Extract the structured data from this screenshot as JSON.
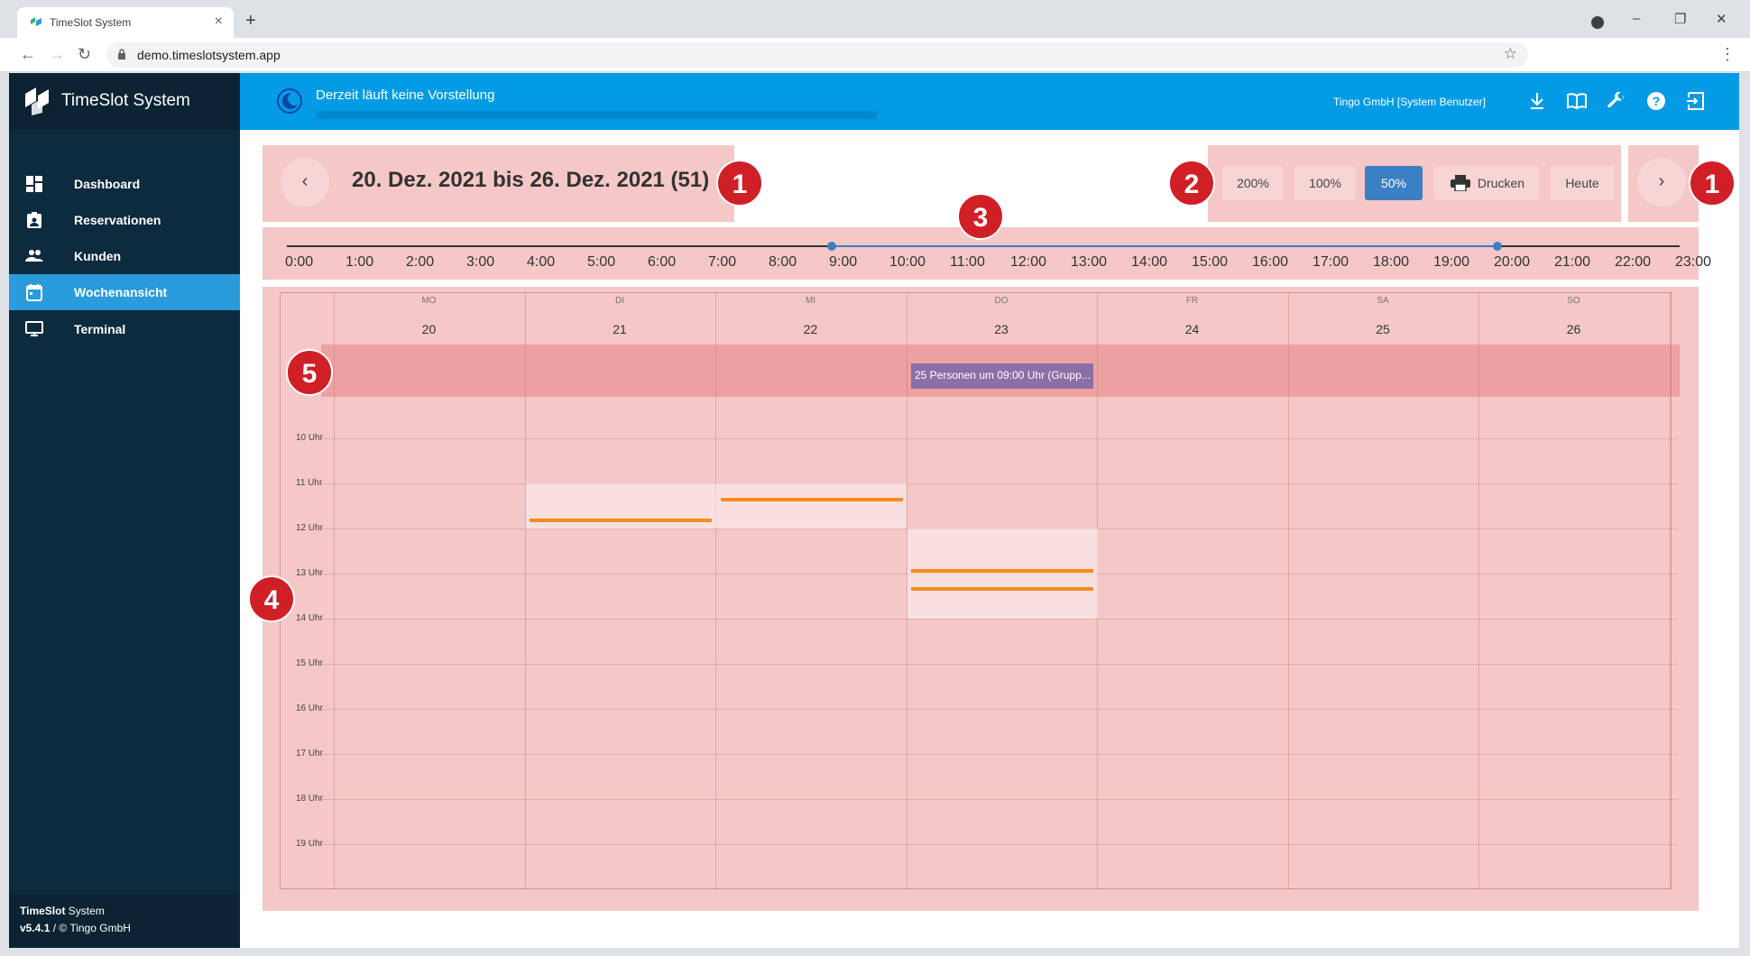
{
  "browser": {
    "tab_title": "TimeSlot System",
    "new_tab": "+",
    "close_tab": "×",
    "url": "demo.timeslotsystem.app",
    "minimize": "–",
    "restore": "❐",
    "close": "✕"
  },
  "sidebar": {
    "brand": "TimeSlot System",
    "items": [
      {
        "label": "Dashboard",
        "icon": "dashboard-icon"
      },
      {
        "label": "Reservationen",
        "icon": "reservation-icon"
      },
      {
        "label": "Kunden",
        "icon": "people-icon"
      },
      {
        "label": "Wochenansicht",
        "icon": "calendar-icon",
        "active": true
      },
      {
        "label": "Terminal",
        "icon": "monitor-icon"
      }
    ],
    "footer_title_bold": "TimeSlot",
    "footer_title_rest": " System",
    "footer_version": "v5.4.1",
    "footer_copy": " / © Tingo GmbH"
  },
  "topbar": {
    "status": "Derzeit läuft keine Vorstellung",
    "user": "Tingo GmbH [System Benutzer]",
    "icons": [
      "download-icon",
      "book-icon",
      "wrench-icon",
      "help-icon",
      "logout-icon"
    ]
  },
  "week": {
    "title": "20. Dez. 2021 bis 26. Dez. 2021 (51)",
    "prev": "‹",
    "next": "›"
  },
  "toolbar": {
    "zoom_200": "200%",
    "zoom_100": "100%",
    "zoom_50": "50%",
    "print": "Drucken",
    "today": "Heute"
  },
  "slider": {
    "labels": [
      "0:00",
      "1:00",
      "2:00",
      "3:00",
      "4:00",
      "5:00",
      "6:00",
      "7:00",
      "8:00",
      "9:00",
      "10:00",
      "11:00",
      "12:00",
      "13:00",
      "14:00",
      "15:00",
      "16:00",
      "17:00",
      "18:00",
      "19:00",
      "20:00",
      "21:00",
      "22:00",
      "23:00"
    ],
    "range_start": "9:00",
    "range_end": "20:00"
  },
  "calendar": {
    "days": [
      {
        "name": "MO",
        "num": "20"
      },
      {
        "name": "DI",
        "num": "21"
      },
      {
        "name": "MI",
        "num": "22"
      },
      {
        "name": "DO",
        "num": "23"
      },
      {
        "name": "FR",
        "num": "24"
      },
      {
        "name": "SA",
        "num": "25"
      },
      {
        "name": "SO",
        "num": "26"
      }
    ],
    "hours": [
      "10 Uhr",
      "11 Uhr",
      "12 Uhr",
      "13 Uhr",
      "14 Uhr",
      "15 Uhr",
      "16 Uhr",
      "17 Uhr",
      "18 Uhr",
      "19 Uhr"
    ],
    "allday_event": "25 Personen um 09:00 Uhr (Grupp..."
  },
  "badges": [
    "1",
    "1",
    "2",
    "3",
    "4",
    "5"
  ],
  "colors": {
    "topbar": "#039be5",
    "sidebar": "#0d2b3e",
    "active_nav": "#2a9bdb",
    "overlay": "#e57373",
    "event": "#8a70a6",
    "marker": "#f58c1f",
    "badge": "#d01f26"
  }
}
